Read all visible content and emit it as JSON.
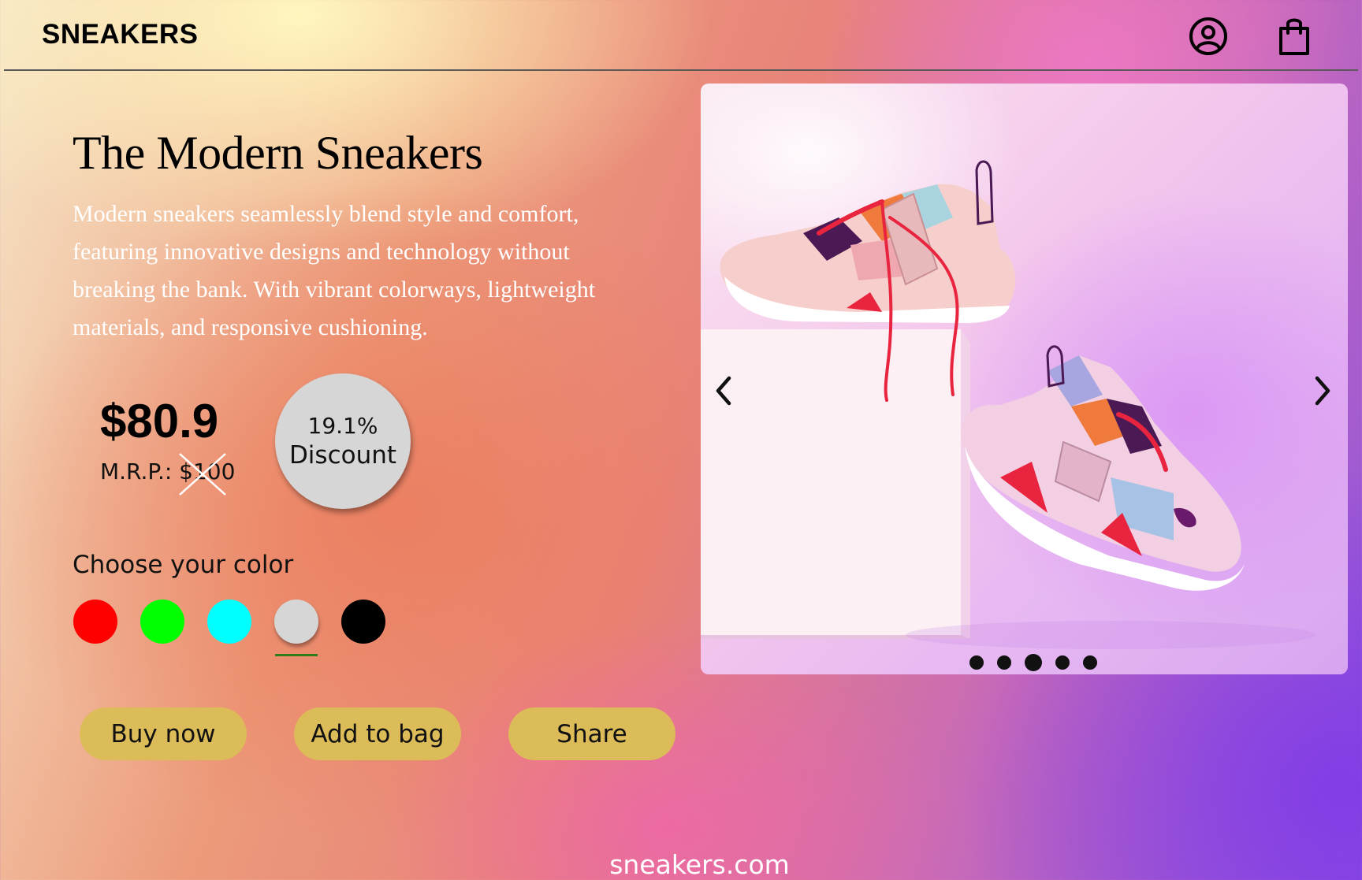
{
  "header": {
    "brand": "SNEAKERS",
    "icons": [
      "user-circle-icon",
      "shopping-bag-icon"
    ]
  },
  "product": {
    "title": "The Modern Sneakers",
    "description": "Modern sneakers seamlessly blend style and comfort, featuring innovative designs and technology without breaking the bank. With vibrant colorways, lightweight materials, and responsive cushioning.",
    "price": "$80.9",
    "mrp": "M.R.P.: $100",
    "discount_percent": "19.1%",
    "discount_label": "Discount"
  },
  "colors": {
    "label": "Choose your color",
    "options": [
      {
        "name": "red",
        "hex": "#ff0000"
      },
      {
        "name": "green",
        "hex": "#00ff00"
      },
      {
        "name": "cyan",
        "hex": "#00ffff"
      },
      {
        "name": "light-gray",
        "hex": "#d6d6d6"
      },
      {
        "name": "black",
        "hex": "#000000"
      }
    ],
    "selected_index": 3
  },
  "actions": {
    "buy_now": "Buy now",
    "add_to_bag": "Add to bag",
    "share": "Share"
  },
  "carousel": {
    "slide_count": 5,
    "active_index": 2,
    "icons": [
      "chevron-left-icon",
      "chevron-right-icon"
    ]
  },
  "footer": {
    "domain": "sneakers.com"
  },
  "theme": {
    "button_color": "#dcbb59",
    "selection_underline": "#2e7d18"
  }
}
